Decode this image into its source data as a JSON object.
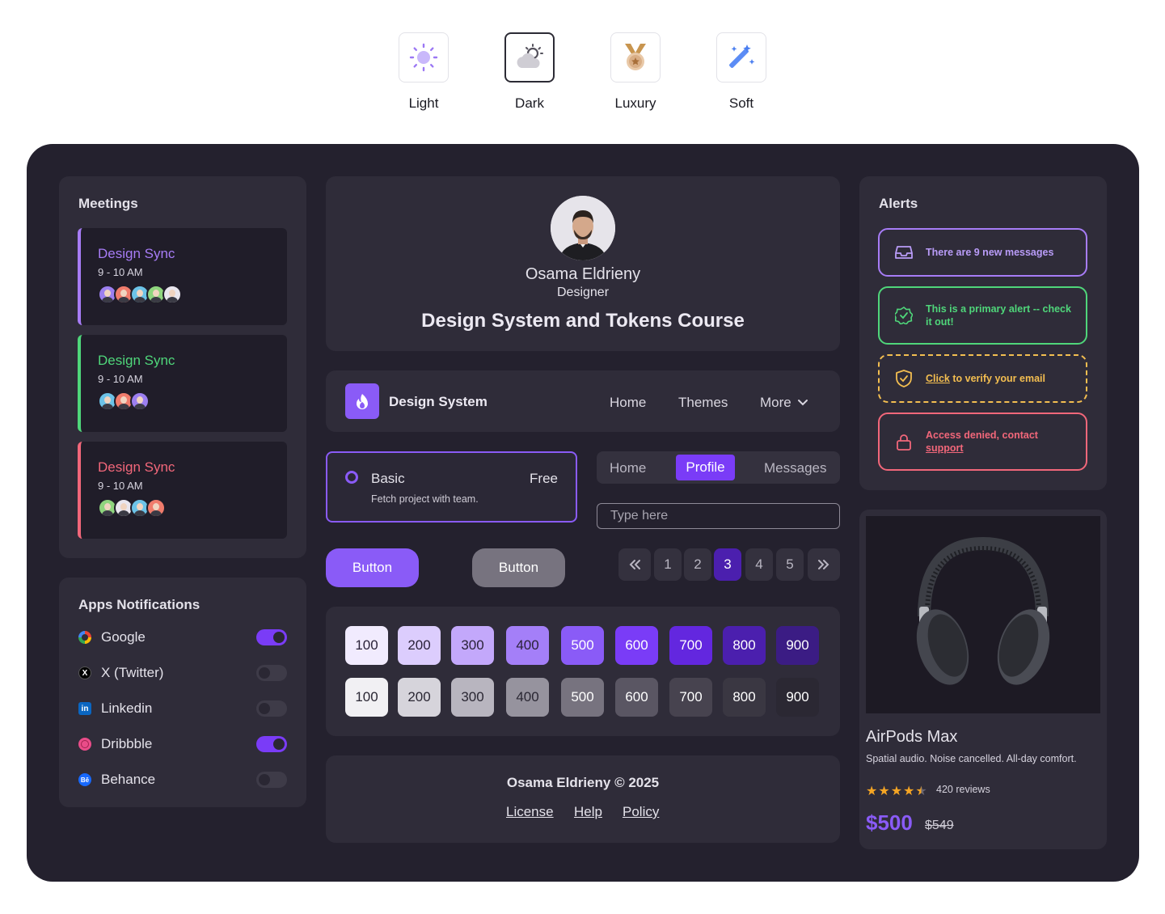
{
  "themes": [
    {
      "label": "Light",
      "icon": "sun-icon"
    },
    {
      "label": "Dark",
      "icon": "cloud-moon-icon"
    },
    {
      "label": "Luxury",
      "icon": "medal-icon"
    },
    {
      "label": "Soft",
      "icon": "magic-wand-icon"
    }
  ],
  "meetings": {
    "title": "Meetings",
    "items": [
      {
        "title": "Design Sync",
        "time": "9 - 10 AM",
        "color": "#a77cf6"
      },
      {
        "title": "Design Sync",
        "time": "9 - 10 AM",
        "color": "#4fd67a"
      },
      {
        "title": "Design Sync",
        "time": "9 - 10 AM",
        "color": "#f2677a"
      }
    ]
  },
  "notifications": {
    "title": "Apps Notifications",
    "items": [
      {
        "name": "Google",
        "on": true
      },
      {
        "name": "X (Twitter)",
        "on": false
      },
      {
        "name": "Linkedin",
        "on": false
      },
      {
        "name": "Dribbble",
        "on": true
      },
      {
        "name": "Behance",
        "on": false
      }
    ]
  },
  "profile": {
    "name": "Osama Eldrieny",
    "role": "Designer",
    "course": "Design System and Tokens Course"
  },
  "navbar": {
    "brand": "Design System",
    "links": [
      "Home",
      "Themes",
      "More"
    ]
  },
  "plan": {
    "name": "Basic",
    "price": "Free",
    "desc": "Fetch project with team."
  },
  "tabs": {
    "items": [
      "Home",
      "Profile",
      "Messages"
    ],
    "active": "Profile"
  },
  "input": {
    "placeholder": "Type here"
  },
  "buttons": {
    "primary": "Button",
    "secondary": "Button"
  },
  "pagination": {
    "pages": [
      "1",
      "2",
      "3",
      "4",
      "5"
    ],
    "current": "3"
  },
  "swatches": {
    "primary": [
      {
        "label": "100",
        "bg": "#f1ebfe",
        "fg": "#2a2238"
      },
      {
        "label": "200",
        "bg": "#dccdfd",
        "fg": "#2a2238"
      },
      {
        "label": "300",
        "bg": "#c3a8fb",
        "fg": "#2a2238"
      },
      {
        "label": "400",
        "bg": "#a47ff8",
        "fg": "#2a2238"
      },
      {
        "label": "500",
        "bg": "#8a5bf7",
        "fg": "#ffffff"
      },
      {
        "label": "600",
        "bg": "#7a3cf7",
        "fg": "#ffffff"
      },
      {
        "label": "700",
        "bg": "#6327df",
        "fg": "#ffffff"
      },
      {
        "label": "800",
        "bg": "#4b1fae",
        "fg": "#ffffff"
      },
      {
        "label": "900",
        "bg": "#3b1c84",
        "fg": "#ffffff"
      }
    ],
    "neutral": [
      {
        "label": "100",
        "bg": "#f1f0f3",
        "fg": "#2a2733"
      },
      {
        "label": "200",
        "bg": "#d6d4db",
        "fg": "#2a2733"
      },
      {
        "label": "300",
        "bg": "#b8b5bf",
        "fg": "#2a2733"
      },
      {
        "label": "400",
        "bg": "#96939e",
        "fg": "#2a2733"
      },
      {
        "label": "500",
        "bg": "#77737f",
        "fg": "#ffffff"
      },
      {
        "label": "600",
        "bg": "#5a5663",
        "fg": "#ffffff"
      },
      {
        "label": "700",
        "bg": "#47434f",
        "fg": "#ffffff"
      },
      {
        "label": "800",
        "bg": "#3a3742",
        "fg": "#ffffff"
      },
      {
        "label": "900",
        "bg": "#2b2833",
        "fg": "#ffffff"
      }
    ]
  },
  "footer": {
    "copyright": "Osama Eldrieny © 2025",
    "links": [
      "License",
      "Help",
      "Policy"
    ]
  },
  "alerts": {
    "title": "Alerts",
    "messages": "There are 9 new messages",
    "primary": "This is a primary alert -- check it out!",
    "verify_link": "Click",
    "verify_text": " to verify your email",
    "denied_text": "Access denied, contact ",
    "denied_link": "support"
  },
  "product": {
    "name": "AirPods Max",
    "desc": "Spatial audio. Noise cancelled. All-day comfort.",
    "rating": 4.5,
    "reviews": "420 reviews",
    "price": "$500",
    "old_price": "$549"
  },
  "colors": {
    "accent": "#7a3cf7",
    "panel": "#24212e",
    "card": "#2f2c39"
  }
}
